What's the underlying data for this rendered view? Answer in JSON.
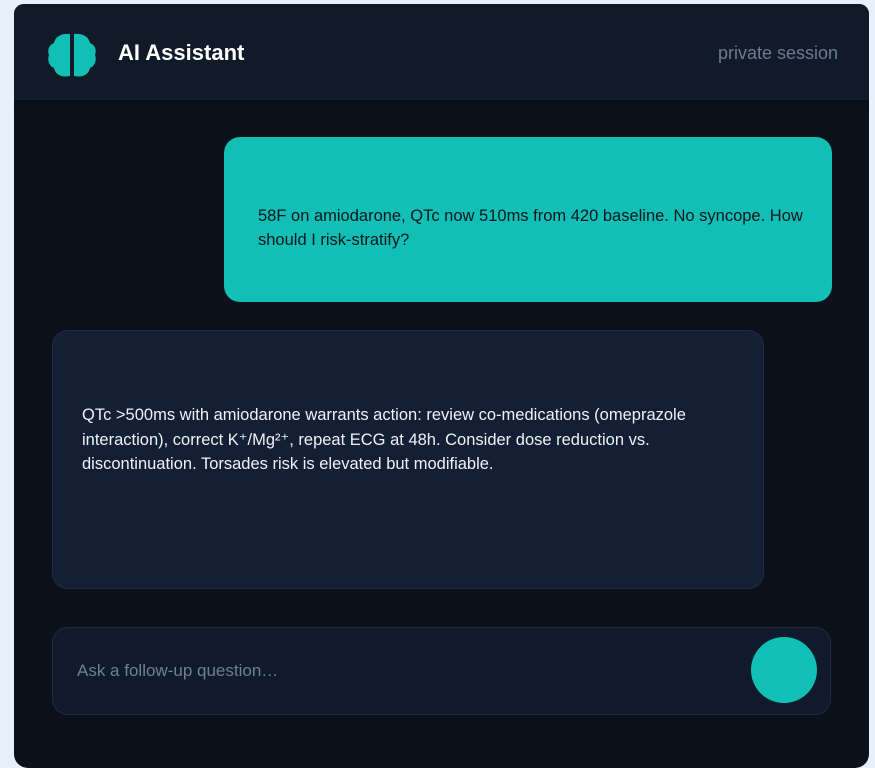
{
  "header": {
    "app_title": "AI Assistant",
    "session_label": "private session",
    "logo_icon": "brain-icon",
    "accent_color": "#12bfb4"
  },
  "conversation": {
    "messages": [
      {
        "role": "user",
        "text": "58F on amiodarone, QTc now 510ms from 420 baseline. No syncope. How should I risk-stratify?"
      },
      {
        "role": "assistant",
        "text": "QTc >500ms with amiodarone warrants action: review co-medications (omeprazole interaction), correct K⁺/Mg²⁺, repeat ECG at 48h. Consider dose reduction vs. discontinuation. Torsades risk is elevated but modifiable."
      }
    ]
  },
  "composer": {
    "placeholder": "Ask a follow-up question…",
    "value": "",
    "send_icon": "send-icon"
  }
}
